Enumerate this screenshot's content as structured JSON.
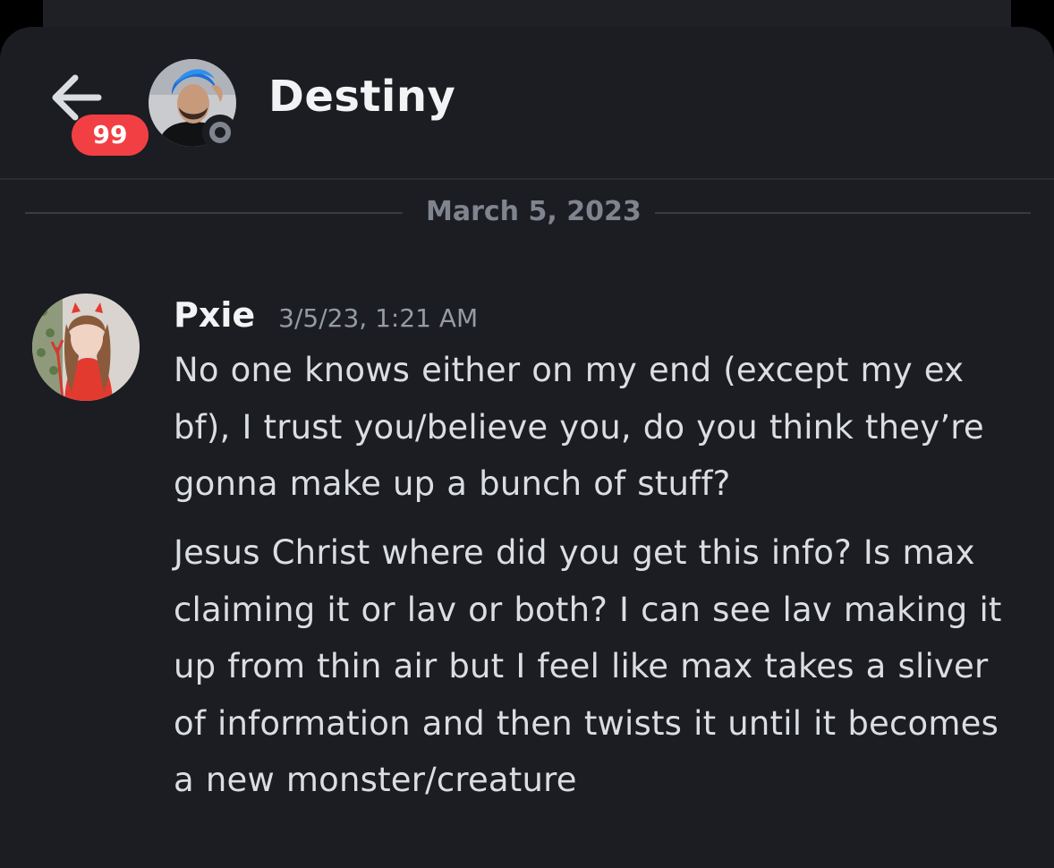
{
  "colors": {
    "background": "#1c1d22",
    "badge": "#f23f43",
    "text_primary": "#f2f3f5",
    "text_body": "#dbdee1",
    "text_muted": "#949ba4",
    "status_offline": "#80848e"
  },
  "header": {
    "back_icon": "arrow-left-icon",
    "unread_count": "99",
    "channel_name": "Destiny",
    "status": "offline"
  },
  "divider": {
    "date": "March 5, 2023"
  },
  "message": {
    "author": "Pxie",
    "timestamp": "3/5/23, 1:21 AM",
    "paragraphs": [
      "No one knows either on my end (except my ex bf), I trust you/believe you, do you think they’re gonna make up a bunch of stuff?",
      "Jesus Christ where did you get this info? Is max claiming it or lav or both? I can see lav making it up from thin air but I feel like max takes a sliver of information and then twists it until it becomes a new monster/creature"
    ]
  }
}
